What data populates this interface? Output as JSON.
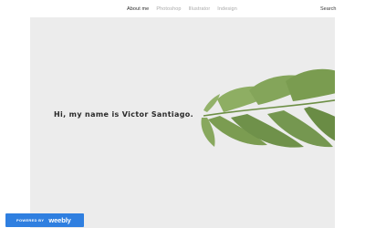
{
  "nav": {
    "items": [
      {
        "label": "About me",
        "active": true
      },
      {
        "label": "Photoshop",
        "active": false
      },
      {
        "label": "Illustrator",
        "active": false
      },
      {
        "label": "Indesign",
        "active": false
      }
    ],
    "search_label": "Search"
  },
  "hero": {
    "heading": "Hi, my name is Victor Santiago.",
    "background_color": "#ececec",
    "image_icon": "monstera-leaf-icon",
    "leaf_color": "#7e9e55"
  },
  "badge": {
    "powered_label": "POWERED BY",
    "brand_label": "weebly",
    "background_color": "#2f7fe0"
  }
}
